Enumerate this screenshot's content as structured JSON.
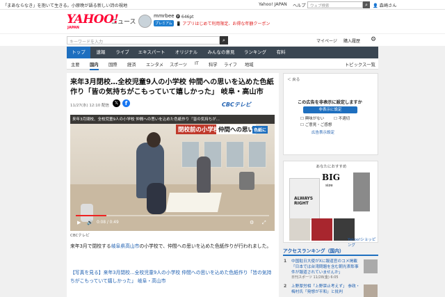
{
  "ticker": {
    "text": "「まあならなき」を抱いて生きる。小原晩が語る新しい詩の視地",
    "links": [
      "Yahoo! JAPAN",
      "ヘルプ"
    ],
    "search_placeholder": "ウェブ検索",
    "user": "森崎さん"
  },
  "brand": {
    "logo": "YAHOO!",
    "logo_sub": "JAPAN",
    "section": "ニュース",
    "username": "mmrbee",
    "premium": "プレミアム",
    "points": "646pt",
    "app_promo": "アプリはじめて利用限定、お得な年額クーポン"
  },
  "search": {
    "placeholder": "キーワードを入力",
    "mypage": "マイページ",
    "history": "購入履歴"
  },
  "nav": {
    "items": [
      "トップ",
      "速報",
      "ライブ",
      "エキスパート",
      "オリジナル",
      "みんなの意見",
      "ランキング",
      "有料"
    ],
    "active": 0
  },
  "subnav": {
    "items": [
      "主要",
      "国内",
      "国際",
      "経済",
      "エンタメ",
      "スポーツ",
      "IT",
      "科学",
      "ライフ",
      "地域"
    ],
    "active": 1,
    "topics": "トピックス一覧"
  },
  "article": {
    "title": "来年3月閉校…全校児童9人の小学校 仲間への思いを込めた色紙作り「皆の気持ちがこもっていて嬉しかった」 岐阜・高山市",
    "datetime": "11/27(水) 12:10 配信",
    "provider_logo": "CBCテレビ",
    "video": {
      "ticker": "来年3月閉校、全校児童9人の小学校 仲間への思いを込めた色紙作り「皆の気持ちが...",
      "tag_red": "閉校前の小学校",
      "tag_white": "仲間への思い",
      "tag_blue": "色紙に",
      "time": "0:08 / 0:49",
      "progress": 0.16
    },
    "credit": "CBCテレビ",
    "lead_prefix": "来年3月で閉校する",
    "lead_link": "岐阜県高山市",
    "lead_suffix": "の小学校で、仲間への思いを込めた色紙作りが行われました。",
    "photo_link": "【写真を見る】来年3月閉校…全校児童9人の小学校 仲間への思いを込めた色紙作り「皆の気持ちがこもっていて嬉しかった」 岐阜・高山市"
  },
  "ad": {
    "back": "＜ 戻る",
    "question": "この広告を非表示に設定しますか",
    "button": "非表示に設定",
    "options": [
      "興味がない",
      "不適切",
      "ご意見・ご感想"
    ],
    "settings": "広告表示設定"
  },
  "ad2": {
    "header": "あなたにおすすめ",
    "big": "BIG",
    "size": "size",
    "jacket_text": "ALWAYS RIGHT",
    "shop": "Yahoo!ショッピング"
  },
  "ranking": {
    "heading": "アクセスランキング（国内）",
    "items": [
      {
        "num": "1",
        "text": "中国駐日大使がXに報道官のコメ掲載「日本では台湾問題を含む朝光表彰事件が報道されていませんか」",
        "source": "日刊スポーツ 11/28(金) 6:05"
      },
      {
        "num": "2",
        "text": "上野厚労相「上野禁止考えず」 参政・梅村氏「発想が平和」と批判",
        "source": ""
      }
    ]
  },
  "colors": {
    "brand_red": "#ff0033",
    "nav_bg": "#3a4652",
    "accent": "#1e6fbf",
    "link": "#1e5fb0"
  }
}
